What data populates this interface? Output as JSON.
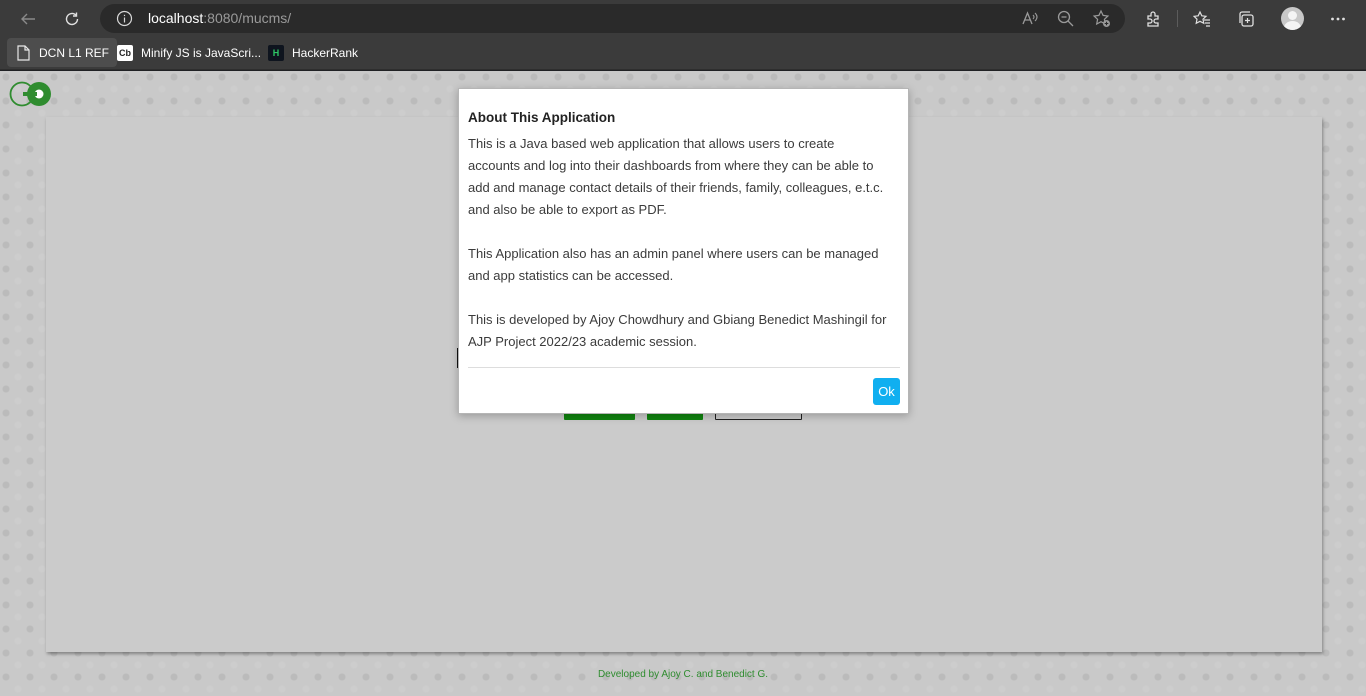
{
  "browser": {
    "url_host": "localhost",
    "url_path": ":8080/mucms/",
    "bookmarks": [
      {
        "label": "DCN L1 REF",
        "icon": "page-icon"
      },
      {
        "label": "Minify JS is JavaScri...",
        "icon": "cb-icon",
        "icon_text": "Cb"
      },
      {
        "label": "HackerRank",
        "icon": "hackerrank-icon",
        "icon_text": "H"
      }
    ]
  },
  "page": {
    "footer": "Developed by Ajoy C. and Benedict G."
  },
  "modal": {
    "title": "About This Application",
    "paragraphs": [
      [
        "This is a Java based web application that allows users to create",
        "accounts and log into their dashboards from where they can be able to",
        "add and manage contact details of their friends, family, colleagues, e.t.c.",
        "and also be able to export as PDF."
      ],
      [
        "This Application also has an admin panel where users can be managed",
        "and app statistics can be accessed."
      ],
      [
        "This is developed by Ajoy Chowdhury and Gbiang Benedict Mashingil for",
        "AJP Project 2022/23 academic session."
      ]
    ],
    "ok_label": "Ok"
  },
  "colors": {
    "accent_green": "#10840f",
    "ok_button": "#10aff0",
    "footer_text": "#2f8c2f"
  }
}
